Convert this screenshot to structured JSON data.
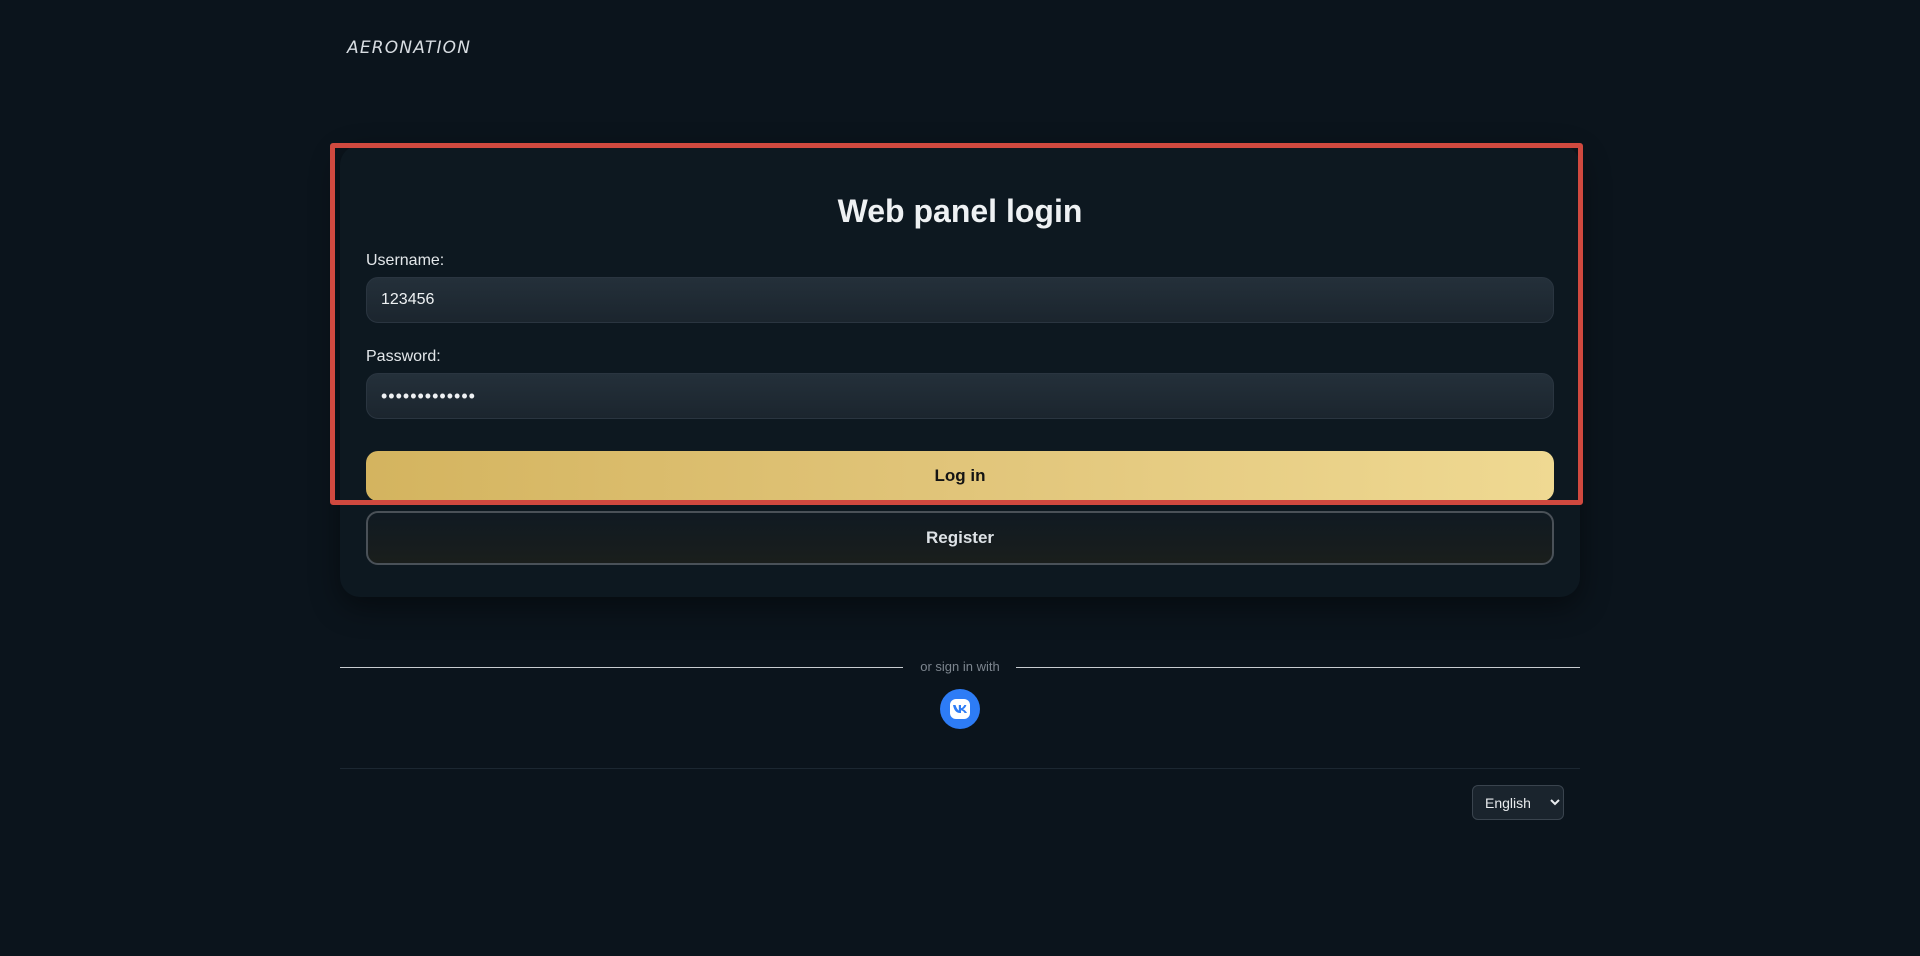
{
  "brand": {
    "logo_text": "AERONATION"
  },
  "login_card": {
    "title": "Web panel login",
    "username_label": "Username:",
    "username_value": "123456",
    "password_label": "Password:",
    "password_value": "•••••••••••••",
    "login_button": "Log in",
    "register_button": "Register"
  },
  "social": {
    "divider_text": "or sign in with",
    "providers": [
      {
        "name": "vk",
        "icon": "vk-icon",
        "color": "#2d7cf6"
      }
    ]
  },
  "footer": {
    "language_selected": "English"
  },
  "colors": {
    "background": "#0b141c",
    "accent_gold": "#e1c57a",
    "highlight_border": "#d0493f",
    "vk_blue": "#2d7cf6"
  }
}
